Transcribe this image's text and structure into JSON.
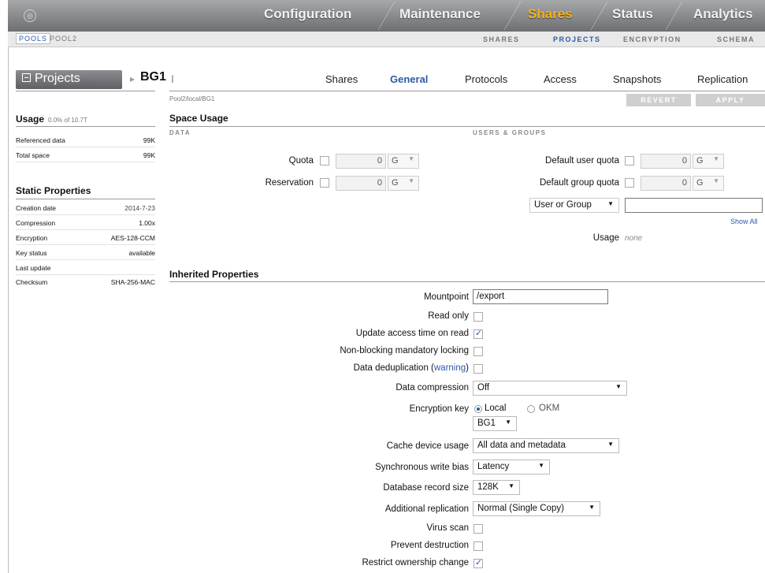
{
  "nav": {
    "tabs": [
      {
        "label": "Configuration",
        "active": false
      },
      {
        "label": "Maintenance",
        "active": false
      },
      {
        "label": "Shares",
        "active": true
      },
      {
        "label": "Status",
        "active": false
      },
      {
        "label": "Analytics",
        "active": false
      }
    ]
  },
  "subnav": {
    "pools": [
      {
        "label": "POOLS",
        "active": true
      },
      {
        "label": "POOL2",
        "active": false
      }
    ],
    "links": [
      {
        "label": "SHARES",
        "active": false
      },
      {
        "label": "PROJECTS",
        "active": true
      },
      {
        "label": "ENCRYPTION",
        "active": false
      },
      {
        "label": "SCHEMA",
        "active": false
      }
    ]
  },
  "header": {
    "projects_button": "Projects",
    "project_name": "BG1",
    "path": "Pool2/local/BG1",
    "tabs": [
      {
        "label": "Shares",
        "active": false
      },
      {
        "label": "General",
        "active": true
      },
      {
        "label": "Protocols",
        "active": false
      },
      {
        "label": "Access",
        "active": false
      },
      {
        "label": "Snapshots",
        "active": false
      },
      {
        "label": "Replication",
        "active": false
      }
    ],
    "revert": "REVERT",
    "apply": "APPLY"
  },
  "usage": {
    "title": "Usage",
    "summary": "0.0% of 10.7T",
    "rows": [
      {
        "key": "Referenced data",
        "value": "99K"
      },
      {
        "key": "Total space",
        "value": "99K"
      }
    ]
  },
  "static_properties": {
    "title": "Static Properties",
    "rows": [
      {
        "key": "Creation date",
        "value": "2014-7-23"
      },
      {
        "key": "Compression",
        "value": "1.00x"
      },
      {
        "key": "Encryption",
        "value": "AES-128-CCM"
      },
      {
        "key": "Key status",
        "value": "available"
      },
      {
        "key": "Last update",
        "value": ""
      },
      {
        "key": "Checksum",
        "value": "SHA-256-MAC"
      }
    ]
  },
  "space_usage": {
    "title": "Space Usage",
    "data_caption": "DATA",
    "users_caption": "USERS & GROUPS",
    "quota": {
      "label": "Quota",
      "value": "0",
      "unit": "G"
    },
    "reservation": {
      "label": "Reservation",
      "value": "0",
      "unit": "G"
    },
    "default_user_quota": {
      "label": "Default user quota",
      "value": "0",
      "unit": "G"
    },
    "default_group_quota": {
      "label": "Default group quota",
      "value": "0",
      "unit": "G"
    },
    "user_or_group": "User or Group",
    "user_group_input": "",
    "show_all": "Show All",
    "usage_label": "Usage",
    "usage_value": "none"
  },
  "inherited": {
    "title": "Inherited Properties",
    "mountpoint_label": "Mountpoint",
    "mountpoint_value": "/export",
    "read_only": "Read only",
    "update_access_time": "Update access time on read",
    "non_blocking": "Non-blocking mandatory locking",
    "dedup_prefix": "Data deduplication (",
    "dedup_link": "warning",
    "dedup_suffix": ")",
    "compression_label": "Data compression",
    "compression_value": "Off",
    "encryption_key_label": "Encryption key",
    "encryption_local": "Local",
    "encryption_okm": "OKM",
    "encryption_key_value": "BG1",
    "cache_label": "Cache device usage",
    "cache_value": "All data and metadata",
    "sync_label": "Synchronous write bias",
    "sync_value": "Latency",
    "record_label": "Database record size",
    "record_value": "128K",
    "replication_label": "Additional replication",
    "replication_value": "Normal (Single Copy)",
    "virus_scan": "Virus scan",
    "prevent_destruction": "Prevent destruction",
    "restrict_ownership": "Restrict ownership change"
  }
}
